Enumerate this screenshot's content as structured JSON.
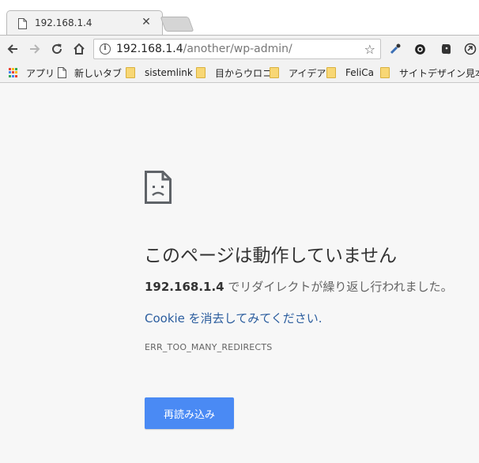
{
  "tab": {
    "title": "192.168.1.4",
    "close_glyph": "✕"
  },
  "toolbar": {
    "url_host": "192.168.1.4",
    "url_path": "/another/wp-admin/",
    "info_glyph": "i",
    "star_glyph": "☆"
  },
  "bookmarks": {
    "items": [
      {
        "label": "アプリ",
        "icon": "apps-grid-icon"
      },
      {
        "label": "新しいタブ",
        "icon": "page-icon"
      },
      {
        "label": "sistemlink",
        "icon": "folder-icon"
      },
      {
        "label": "目からウロコ",
        "icon": "folder-icon"
      },
      {
        "label": "アイデア",
        "icon": "folder-icon"
      },
      {
        "label": "FeliCa",
        "icon": "folder-icon"
      },
      {
        "label": "サイトデザイン見本",
        "icon": "folder-icon"
      }
    ]
  },
  "error": {
    "heading": "このページは動作していません",
    "host": "192.168.1.4",
    "description_rest": " でリダイレクトが繰り返し行われました。",
    "suggestion": "Cookie を消去してみてください.",
    "code": "ERR_TOO_MANY_REDIRECTS",
    "reload_label": "再読み込み"
  },
  "colors": {
    "reload_button": "#4a8af4",
    "suggestion_link": "#2b5d9e",
    "folder": "#f8d775"
  }
}
